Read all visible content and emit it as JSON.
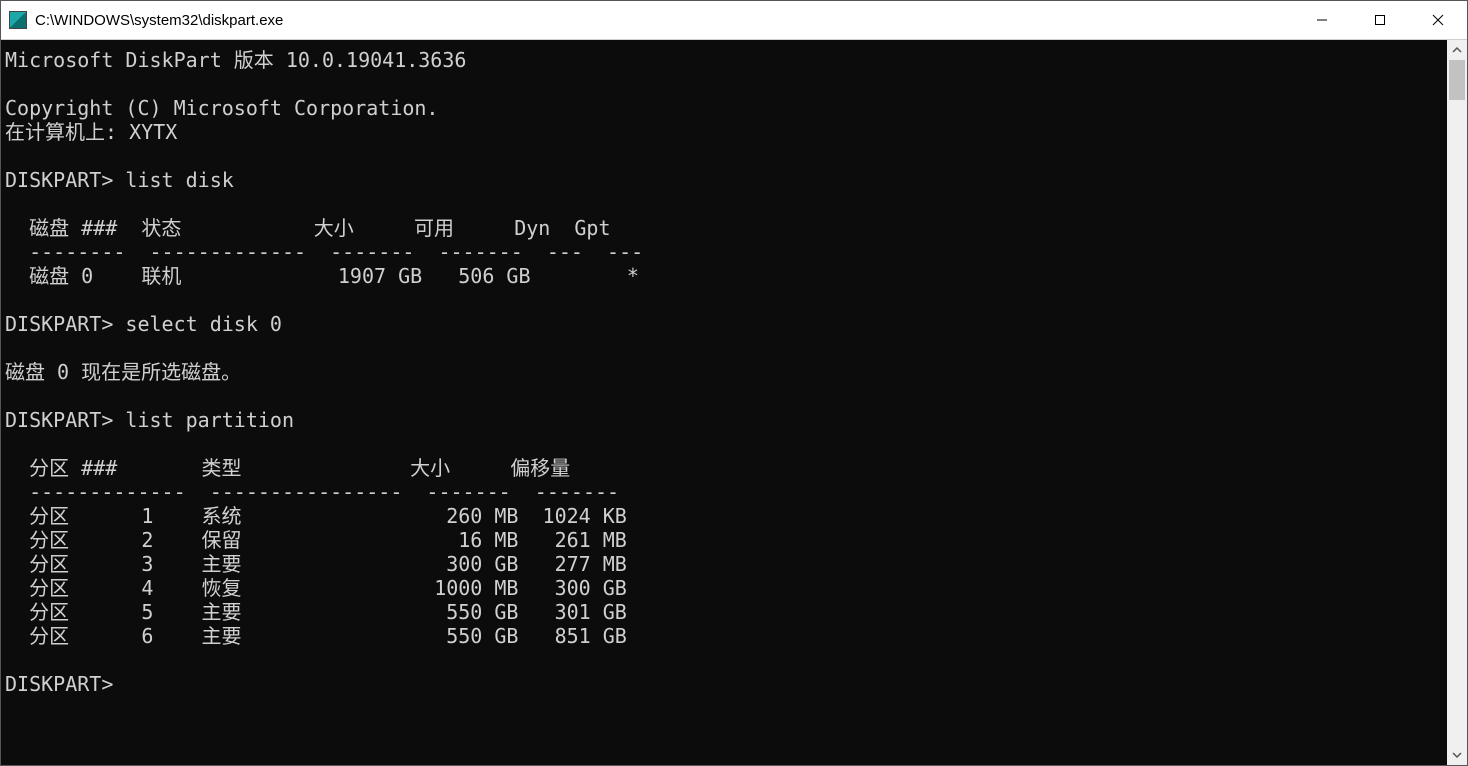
{
  "window": {
    "title": "C:\\WINDOWS\\system32\\diskpart.exe"
  },
  "terminal": {
    "version_line": "Microsoft DiskPart 版本 10.0.19041.3636",
    "copyright_line": "Copyright (C) Microsoft Corporation.",
    "computer_line": "在计算机上: XYTX",
    "prompt": "DISKPART>",
    "cmd_list_disk": "list disk",
    "cmd_select_disk": "select disk 0",
    "cmd_list_partition": "list partition",
    "select_disk_response": "磁盘 0 现在是所选磁盘。",
    "disk_table": {
      "header": "  磁盘 ###  状态           大小     可用     Dyn  Gpt",
      "divider": "  --------  -------------  -------  -------  ---  ---",
      "rows": [
        "  磁盘 0    联机             1907 GB   506 GB        *"
      ]
    },
    "partition_table": {
      "header": "  分区 ###       类型              大小     偏移量",
      "divider": "  -------------  ----------------  -------  -------",
      "rows": [
        "  分区      1    系统                 260 MB  1024 KB",
        "  分区      2    保留                  16 MB   261 MB",
        "  分区      3    主要                 300 GB   277 MB",
        "  分区      4    恢复                1000 MB   300 GB",
        "  分区      5    主要                 550 GB   301 GB",
        "  分区      6    主要                 550 GB   851 GB"
      ]
    }
  }
}
